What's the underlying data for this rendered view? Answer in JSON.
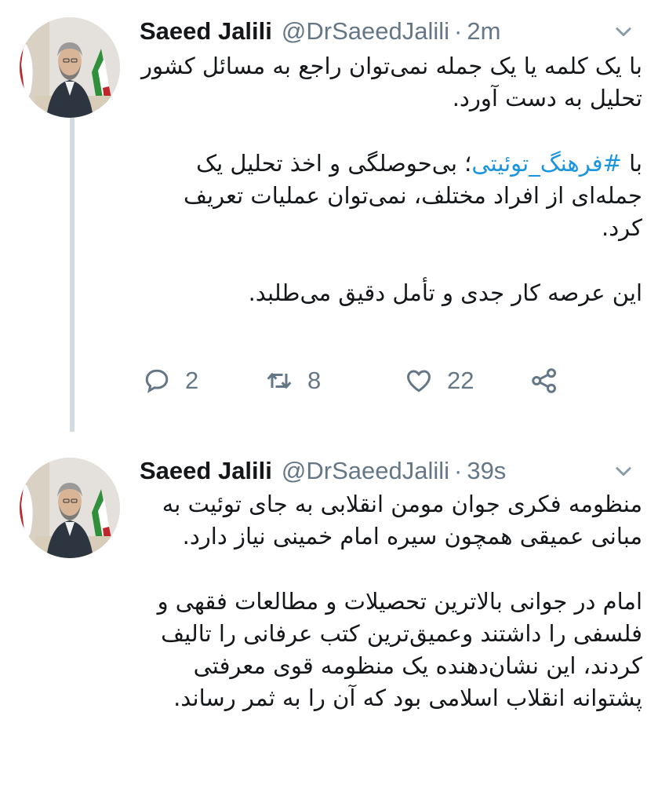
{
  "tweets": [
    {
      "display_name": "Saeed Jalili",
      "handle": "@DrSaeedJalili",
      "separator": "·",
      "time": "2m",
      "paragraphs": [
        "با یک کلمه یا یک جمله نمی‌توان راجع به مسائل کشور تحلیل به دست آورد.",
        "بی‌حوصلگی و اخذ تحلیل یک جمله‌ای از افراد مختلف، نمی‌توان عملیات تعریف کرد.",
        "این عرصه کار جدی و تأمل دقیق می‌طلبد."
      ],
      "hashtag_prefix": "با ",
      "hashtag": "#فرهنگ_توئیتی",
      "hashtag_suffix": "؛ ",
      "actions": {
        "replies": "2",
        "retweets": "8",
        "likes": "22"
      }
    },
    {
      "display_name": "Saeed Jalili",
      "handle": "@DrSaeedJalili",
      "separator": "·",
      "time": "39s",
      "paragraphs": [
        "منظومه فکری جوان مومن انقلابی به جای توئیت به مبانی عمیقی همچون سیره امام خمینی نیاز دارد.",
        "امام در جوانی بالاترین تحصیلات و مطالعات فقهی و فلسفی را داشتند وعمیق‌ترین کتب عرفانی را تالیف کردند، این نشان‌دهنده یک منظومه قوی معرفتی پشتوانه انقلاب اسلامی بود که آن را به ثمر رساند."
      ]
    }
  ],
  "colors": {
    "text": "#14171a",
    "muted": "#657786",
    "link": "#1b95e0",
    "thread_line": "#d3dce3"
  },
  "icons": [
    "reply-icon",
    "retweet-icon",
    "like-icon",
    "share-icon",
    "chevron-down-icon"
  ]
}
